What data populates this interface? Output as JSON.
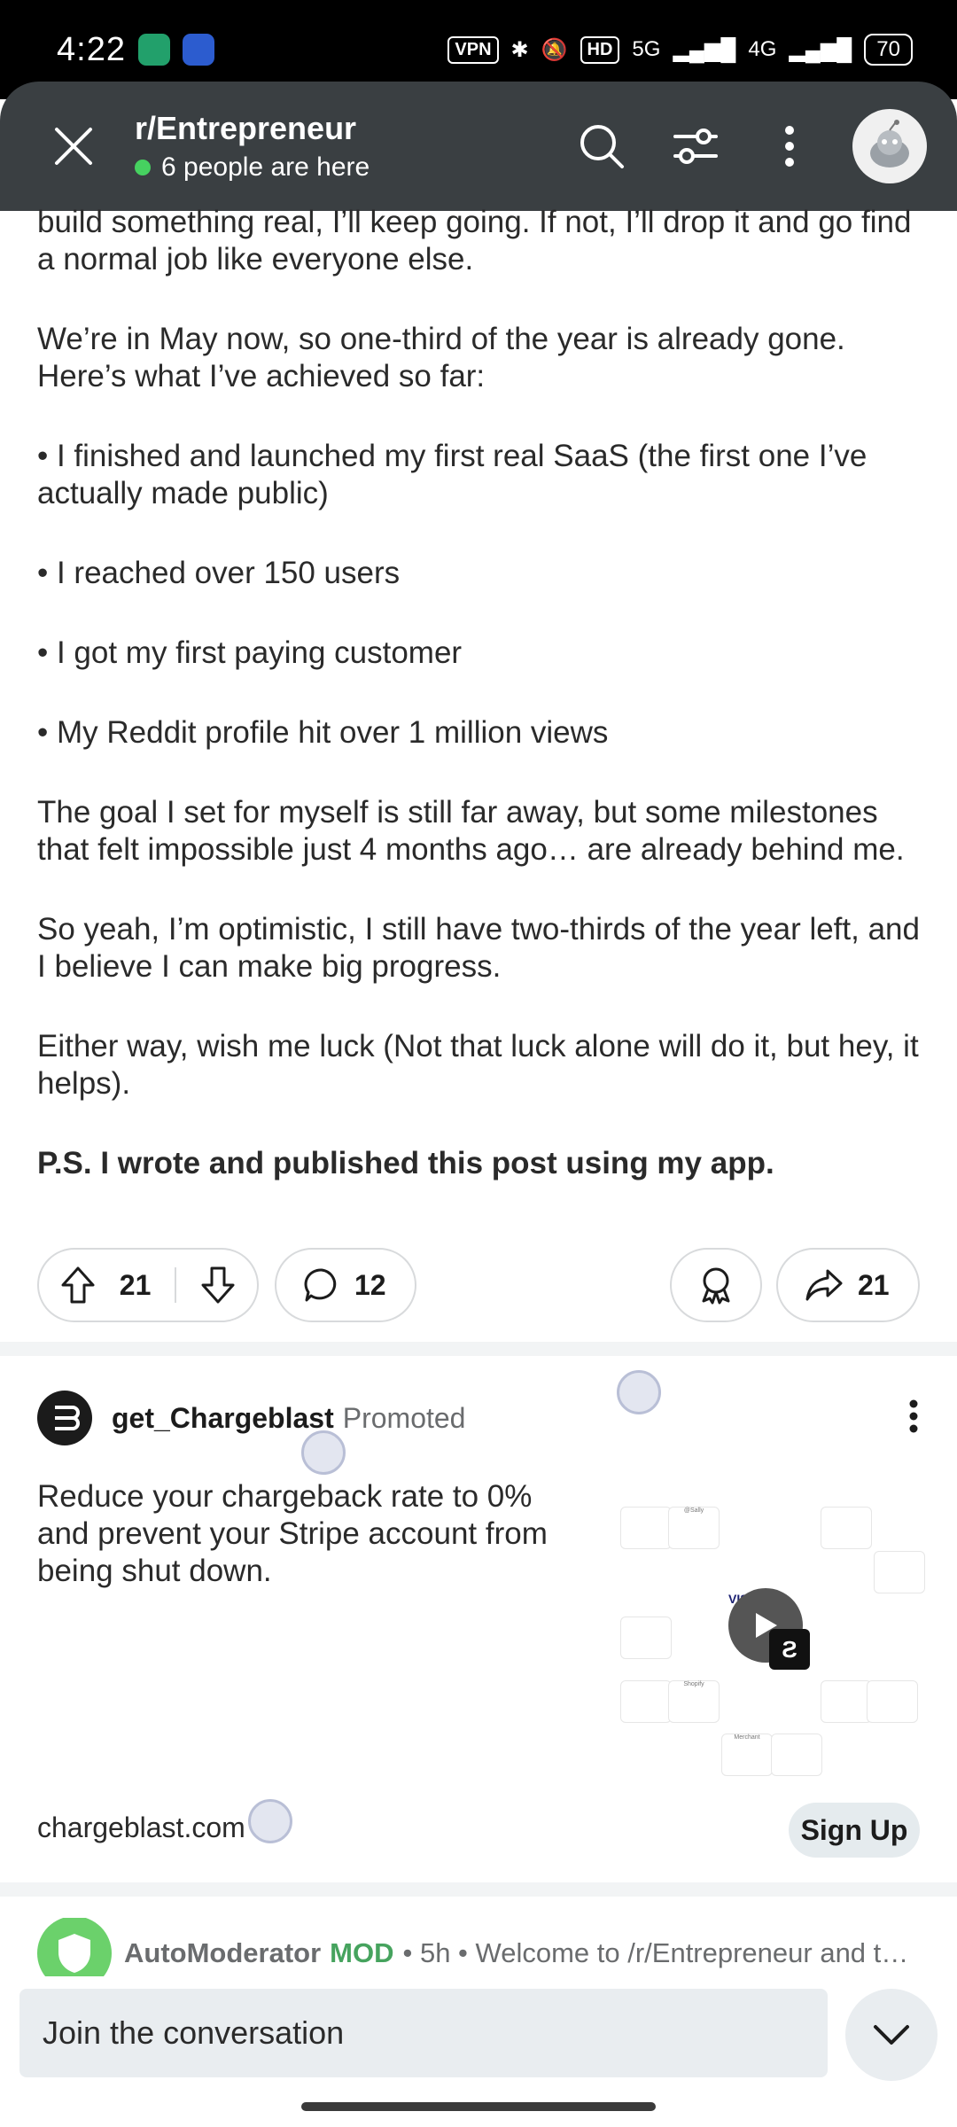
{
  "status_bar": {
    "time": "4:22",
    "vpn": "VPN",
    "hd": "HD",
    "net1": "5G",
    "net2": "4G",
    "battery": "70"
  },
  "header": {
    "subreddit": "r/Entrepreneur",
    "presence": "6 people are here"
  },
  "post": {
    "paragraphs": [
      "build something real, I’ll keep going. If not, I’ll drop it and go find a normal job like everyone else.",
      "We’re in May now, so one-third of the year is already gone. Here’s what I’ve achieved so far:",
      "• I finished and launched my first real SaaS (the first one I’ve actually made public)",
      "• I reached over 150 users",
      "• I got my first paying customer",
      "• My Reddit profile hit over 1 million views",
      "The goal I set for myself is still far away, but some milestones that felt impossible just 4 months ago… are already behind me.",
      "So yeah, I’m optimistic, I still have two-thirds of the year left, and I believe I can make big progress.",
      "Either way, wish me luck (Not that luck alone will do it, but hey, it helps).",
      "P.S. I wrote and published this post using my app."
    ],
    "votes": "21",
    "comments": "12",
    "shares": "21"
  },
  "promo": {
    "advertiser": "get_Chargeblast",
    "tag": "Promoted",
    "text": "Reduce your chargeback rate to 0% and prevent your Stripe account from being shut down.",
    "domain": "chargeblast.com",
    "cta": "Sign Up",
    "media_labels": {
      "sally": "@Sally",
      "visa": "VISA",
      "shopify": "Shopify",
      "merchant": "Merchant"
    }
  },
  "automod": {
    "name": "AutoModerator",
    "badge": "MOD",
    "rest": "• 5h • Welcome to /r/Entrepreneur and tha..."
  },
  "compose": {
    "placeholder": "Join the conversation"
  }
}
